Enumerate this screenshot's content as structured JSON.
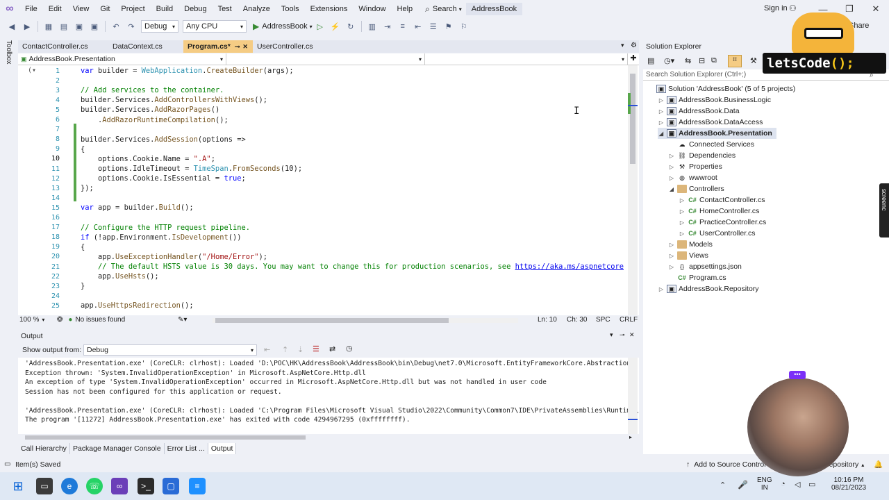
{
  "menu": {
    "items": [
      "File",
      "Edit",
      "View",
      "Git",
      "Project",
      "Build",
      "Debug",
      "Test",
      "Analyze",
      "Tools",
      "Extensions",
      "Window",
      "Help"
    ],
    "search_label": "Search",
    "solution_title": "AddressBook",
    "sign_in": "Sign in"
  },
  "toolbar": {
    "config": "Debug",
    "platform": "Any CPU",
    "run_target": "AddressBook",
    "share": "Share"
  },
  "toolbox_label": "Toolbox",
  "editor": {
    "tabs": [
      {
        "label": "ContactController.cs",
        "active": false
      },
      {
        "label": "DataContext.cs",
        "active": false
      },
      {
        "label": "Program.cs*",
        "active": true
      },
      {
        "label": "UserController.cs",
        "active": false
      }
    ],
    "nav_project": "AddressBook.Presentation",
    "zoom": "100 %",
    "issues": "No issues found",
    "cursor_line": "Ln: 10",
    "cursor_col": "Ch: 30",
    "whitespace": "SPC",
    "line_ending": "CRLF"
  },
  "code_lines": [
    {
      "n": "1",
      "html": "<span class='kw'>var</span> builder = <span class='ty'>WebApplication</span>.<span class='mt'>CreateBuilder</span>(args);"
    },
    {
      "n": "2",
      "html": ""
    },
    {
      "n": "3",
      "html": "<span class='cm'>// Add services to the container.</span>"
    },
    {
      "n": "4",
      "html": "builder.Services.<span class='mt'>AddControllersWithViews</span>();"
    },
    {
      "n": "5",
      "html": "builder.Services.<span class='mt'>AddRazorPages</span>()"
    },
    {
      "n": "6",
      "html": "    .<span class='mt'>AddRazorRuntimeCompilation</span>();"
    },
    {
      "n": "7",
      "html": ""
    },
    {
      "n": "8",
      "html": "builder.Services.<span class='mt'>AddSession</span>(options =>"
    },
    {
      "n": "9",
      "html": "{"
    },
    {
      "n": "10",
      "html": "    options.Cookie.Name = <span class='st'>\".A\"</span>;"
    },
    {
      "n": "11",
      "html": "    options.IdleTimeout = <span class='ty'>TimeSpan</span>.<span class='mt'>FromSeconds</span>(10);"
    },
    {
      "n": "12",
      "html": "    options.Cookie.IsEssential = <span class='kw'>true</span>;"
    },
    {
      "n": "13",
      "html": "});"
    },
    {
      "n": "14",
      "html": ""
    },
    {
      "n": "15",
      "html": "<span class='kw'>var</span> app = builder.<span class='mt'>Build</span>();"
    },
    {
      "n": "16",
      "html": ""
    },
    {
      "n": "17",
      "html": "<span class='cm'>// Configure the HTTP request pipeline.</span>"
    },
    {
      "n": "18",
      "html": "<span class='kw'>if</span> (!app.Environment.<span class='mt'>IsDevelopment</span>())"
    },
    {
      "n": "19",
      "html": "{"
    },
    {
      "n": "20",
      "html": "    app.<span class='mt'>UseExceptionHandler</span>(<span class='st'>\"/Home/Error\"</span>);"
    },
    {
      "n": "21",
      "html": "    <span class='cm'>// The default HSTS value is 30 days. You may want to change this for production scenarios, see </span><span class='lk'>https://aka.ms/aspnetcore</span>"
    },
    {
      "n": "22",
      "html": "    app.<span class='mt'>UseHsts</span>();"
    },
    {
      "n": "23",
      "html": "}"
    },
    {
      "n": "24",
      "html": ""
    },
    {
      "n": "25",
      "html": "app.<span class='mt'>UseHttpsRedirection</span>();"
    }
  ],
  "output": {
    "title": "Output",
    "show_from_label": "Show output from:",
    "source": "Debug",
    "lines": [
      "'AddressBook.Presentation.exe' (CoreCLR: clrhost): Loaded 'D:\\POC\\HK\\AddressBook\\AddressBook\\bin\\Debug\\net7.0\\Microsoft.EntityFrameworkCore.Abstractions.dll'. Skip",
      "Exception thrown: 'System.InvalidOperationException' in Microsoft.AspNetCore.Http.dll",
      "An exception of type 'System.InvalidOperationException' occurred in Microsoft.AspNetCore.Http.dll but was not handled in user code",
      "Session has not been configured for this application or request.",
      "",
      "'AddressBook.Presentation.exe' (CoreCLR: clrhost): Loaded 'C:\\Program Files\\Microsoft Visual Studio\\2022\\Community\\Common7\\IDE\\PrivateAssemblies\\Runtime\\Microsoft.",
      "The program '[11272] AddressBook.Presentation.exe' has exited with code 4294967295 (0xffffffff)."
    ]
  },
  "bottom_tabs": [
    {
      "label": "Call Hierarchy",
      "active": false
    },
    {
      "label": "Package Manager Console",
      "active": false
    },
    {
      "label": "Error List ...",
      "active": false
    },
    {
      "label": "Output",
      "active": true
    }
  ],
  "solution_explorer": {
    "title": "Solution Explorer",
    "search_placeholder": "Search Solution Explorer (Ctrl+;)",
    "tree": [
      {
        "label": "Solution 'AddressBook' (5 of 5 projects)",
        "depth": 0,
        "icon": "solution",
        "expander": "",
        "bold": false
      },
      {
        "label": "AddressBook.BusinessLogic",
        "depth": 1,
        "icon": "project",
        "expander": "▷",
        "bold": false
      },
      {
        "label": "AddressBook.Data",
        "depth": 1,
        "icon": "project",
        "expander": "▷",
        "bold": false
      },
      {
        "label": "AddressBook.DataAccess",
        "depth": 1,
        "icon": "project",
        "expander": "▷",
        "bold": false
      },
      {
        "label": "AddressBook.Presentation",
        "depth": 1,
        "icon": "project",
        "expander": "◢",
        "bold": true
      },
      {
        "label": "Connected Services",
        "depth": 2,
        "icon": "connected",
        "expander": "",
        "bold": false
      },
      {
        "label": "Dependencies",
        "depth": 2,
        "icon": "dependencies",
        "expander": "▷",
        "bold": false
      },
      {
        "label": "Properties",
        "depth": 2,
        "icon": "properties",
        "expander": "▷",
        "bold": false
      },
      {
        "label": "wwwroot",
        "depth": 2,
        "icon": "globe",
        "expander": "▷",
        "bold": false
      },
      {
        "label": "Controllers",
        "depth": 2,
        "icon": "folder",
        "expander": "◢",
        "bold": false
      },
      {
        "label": "ContactController.cs",
        "depth": 3,
        "icon": "cs",
        "expander": "▷",
        "bold": false
      },
      {
        "label": "HomeController.cs",
        "depth": 3,
        "icon": "cs",
        "expander": "▷",
        "bold": false
      },
      {
        "label": "PracticeController.cs",
        "depth": 3,
        "icon": "cs",
        "expander": "▷",
        "bold": false
      },
      {
        "label": "UserController.cs",
        "depth": 3,
        "icon": "cs",
        "expander": "▷",
        "bold": false
      },
      {
        "label": "Models",
        "depth": 2,
        "icon": "folder",
        "expander": "▷",
        "bold": false
      },
      {
        "label": "Views",
        "depth": 2,
        "icon": "folder",
        "expander": "▷",
        "bold": false
      },
      {
        "label": "appsettings.json",
        "depth": 2,
        "icon": "json",
        "expander": "▷",
        "bold": false
      },
      {
        "label": "Program.cs",
        "depth": 2,
        "icon": "cs",
        "expander": "",
        "bold": false
      },
      {
        "label": "AddressBook.Repository",
        "depth": 1,
        "icon": "project",
        "expander": "▷",
        "bold": false
      }
    ]
  },
  "status": {
    "message": "Item(s) Saved",
    "source_control": "Add to Source Control",
    "repository": "Repository"
  },
  "taskbar": {
    "lang": "ENG",
    "lang_sub": "IN",
    "time": "10:16 PM",
    "date": "08/21/2023"
  },
  "overlay": {
    "brand_text": "letsCode",
    "brand_suffix": "();",
    "screencast_label": "screenc"
  },
  "colors": {
    "active_tab": "#f5cc84",
    "accent_purple": "#8661c5",
    "change_bar": "#57a64a"
  }
}
